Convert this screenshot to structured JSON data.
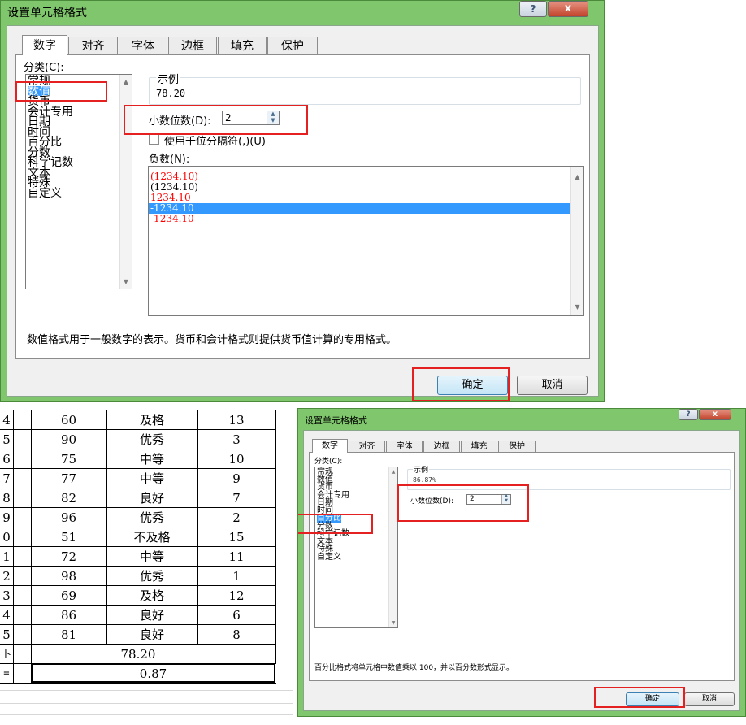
{
  "dialog1": {
    "title": "设置单元格格式",
    "help_glyph": "?",
    "close_glyph": "x",
    "tabs": [
      "数字",
      "对齐",
      "字体",
      "边框",
      "填充",
      "保护"
    ],
    "category_label": "分类(C):",
    "categories": [
      "常规",
      "数值",
      "货币",
      "会计专用",
      "日期",
      "时间",
      "百分比",
      "分数",
      "科学记数",
      "文本",
      "特殊",
      "自定义"
    ],
    "selected_category": "数值",
    "sample_label": "示例",
    "sample_value": "78.20",
    "decimal_label": "小数位数(D):",
    "decimal_value": "2",
    "thousands_label": "使用千位分隔符(,)(U)",
    "negative_label": "负数(N):",
    "negatives": [
      "(1234.10)",
      "(1234.10)",
      "1234.10",
      "-1234.10",
      "-1234.10"
    ],
    "description": "数值格式用于一般数字的表示。货币和会计格式则提供货币值计算的专用格式。",
    "ok_label": "确定",
    "cancel_label": "取消",
    "negative_red_color": "#ff0000",
    "highlight_color": "#3399ff"
  },
  "sheet": {
    "rows": [
      {
        "id": "4",
        "score": "60",
        "grade": "及格",
        "rank": "13"
      },
      {
        "id": "5",
        "score": "90",
        "grade": "优秀",
        "rank": "3"
      },
      {
        "id": "6",
        "score": "75",
        "grade": "中等",
        "rank": "10"
      },
      {
        "id": "7",
        "score": "77",
        "grade": "中等",
        "rank": "9"
      },
      {
        "id": "8",
        "score": "82",
        "grade": "良好",
        "rank": "7"
      },
      {
        "id": "9",
        "score": "96",
        "grade": "优秀",
        "rank": "2"
      },
      {
        "id": "0",
        "score": "51",
        "grade": "不及格",
        "rank": "15"
      },
      {
        "id": "1",
        "score": "72",
        "grade": "中等",
        "rank": "11"
      },
      {
        "id": "2",
        "score": "98",
        "grade": "优秀",
        "rank": "1"
      },
      {
        "id": "3",
        "score": "69",
        "grade": "及格",
        "rank": "12"
      },
      {
        "id": "4",
        "score": "86",
        "grade": "良好",
        "rank": "6"
      },
      {
        "id": "5",
        "score": "81",
        "grade": "良好",
        "rank": "8"
      }
    ],
    "average_value": "78.20",
    "percent_value": "0.87",
    "row_label_a": "卜",
    "row_label_b": "≡"
  },
  "dialog2": {
    "title": "设置单元格格式",
    "help_glyph": "?",
    "close_glyph": "x",
    "tabs": [
      "数字",
      "对齐",
      "字体",
      "边框",
      "填充",
      "保护"
    ],
    "category_label": "分类(C):",
    "categories": [
      "常规",
      "数值",
      "货币",
      "会计专用",
      "日期",
      "时间",
      "百分比",
      "分数",
      "科学记数",
      "文本",
      "特殊",
      "自定义"
    ],
    "selected_category": "百分比",
    "sample_label": "示例",
    "sample_value": "86.87%",
    "decimal_label": "小数位数(D):",
    "decimal_value": "2",
    "description": "百分比格式将单元格中数值乘以 100，并以百分数形式显示。",
    "ok_label": "确定",
    "cancel_label": "取消"
  }
}
